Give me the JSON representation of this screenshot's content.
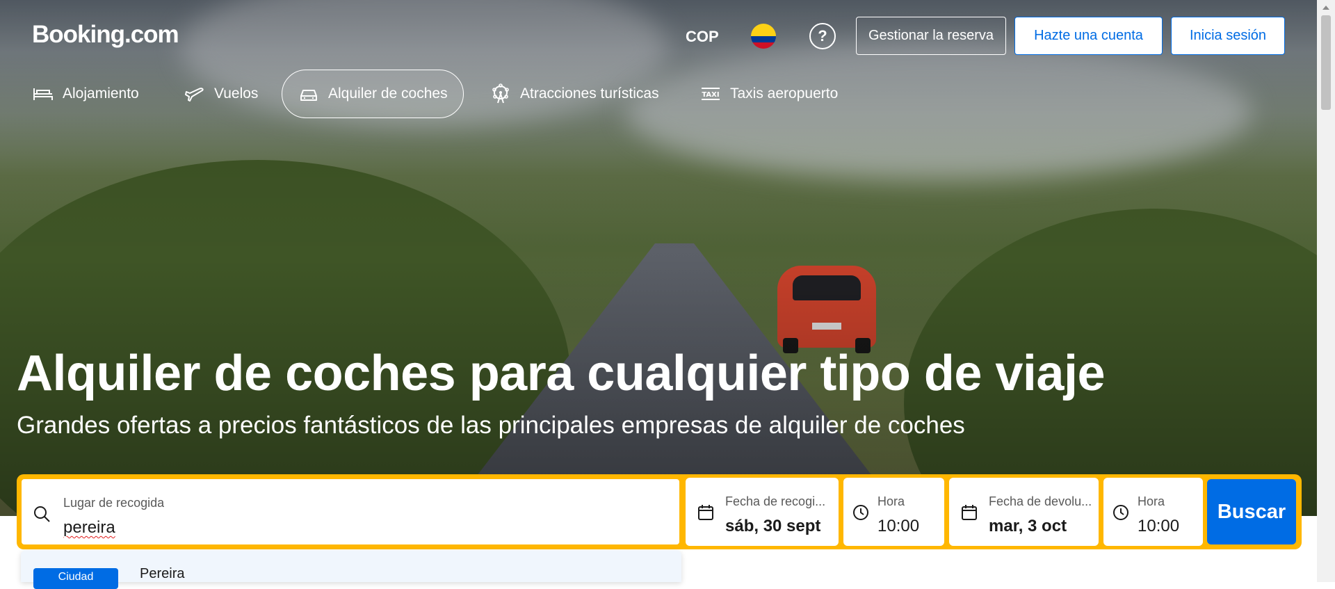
{
  "header": {
    "logo": "Booking.com",
    "currency": "COP",
    "help_symbol": "?",
    "manage_booking": "Gestionar la reserva",
    "register": "Hazte una cuenta",
    "sign_in": "Inicia sesión"
  },
  "nav": {
    "items": [
      {
        "label": "Alojamiento",
        "icon": "bed-icon",
        "active": false
      },
      {
        "label": "Vuelos",
        "icon": "plane-icon",
        "active": false
      },
      {
        "label": "Alquiler de coches",
        "icon": "car-icon",
        "active": true
      },
      {
        "label": "Atracciones turísticas",
        "icon": "ferris-wheel-icon",
        "active": false
      },
      {
        "label": "Taxis aeropuerto",
        "icon": "taxi-icon",
        "active": false
      }
    ]
  },
  "hero": {
    "title": "Alquiler de coches para cualquier tipo de viaje",
    "subtitle": "Grandes ofertas a precios fantásticos de las principales empresas de alquiler de coches"
  },
  "search": {
    "pickup_label": "Lugar de recogida",
    "pickup_value": "pereira",
    "pickup_date_label": "Fecha de recogi...",
    "pickup_date_value": "sáb, 30 sept",
    "pickup_time_label": "Hora",
    "pickup_time_value": "10:00",
    "return_date_label": "Fecha de devolu...",
    "return_date_value": "mar, 3 oct",
    "return_time_label": "Hora",
    "return_time_value": "10:00",
    "submit": "Buscar"
  },
  "suggestions": [
    {
      "type": "Ciudad",
      "name": "Pereira"
    }
  ],
  "colors": {
    "brand_blue": "#006ce4",
    "search_border": "#ffb700",
    "dropdown_bg": "#f0f6fd"
  }
}
